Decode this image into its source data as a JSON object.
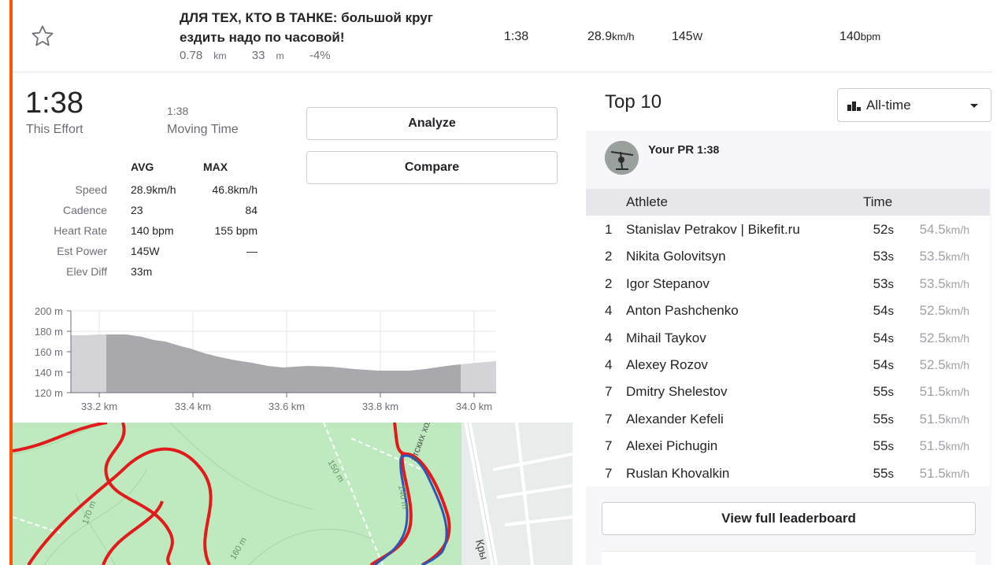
{
  "segment": {
    "title": "ДЛЯ ТЕХ, КТО В ТАНКЕ: большой круг ездить надо по часовой!",
    "distance_value": "0.78",
    "distance_unit": "km",
    "elev_value": "33",
    "elev_unit": "m",
    "grade": "-4%",
    "time": "1:38",
    "speed_value": "28.9",
    "speed_unit": "km/h",
    "power_value": "145",
    "power_unit": "W",
    "hr_value": "140",
    "hr_unit": "bpm"
  },
  "effort": {
    "time": "1:38",
    "time_label": "This Effort",
    "moving_time": "1:38",
    "moving_label": "Moving Time"
  },
  "buttons": {
    "analyze": "Analyze",
    "compare": "Compare"
  },
  "stats": {
    "avg_header": "AVG",
    "max_header": "MAX",
    "rows": [
      {
        "label": "Speed",
        "avg": "28.9km/h",
        "max": "46.8km/h"
      },
      {
        "label": "Cadence",
        "avg": "23",
        "max": "84"
      },
      {
        "label": "Heart Rate",
        "avg": "140 bpm",
        "max": "155 bpm"
      },
      {
        "label": "Est Power",
        "avg": "145W",
        "max": "—"
      },
      {
        "label": "Elev Diff",
        "avg": "33m",
        "max": ""
      }
    ]
  },
  "elevation_chart": {
    "y_ticks": [
      "200 m",
      "180 m",
      "160 m",
      "140 m",
      "120 m"
    ],
    "x_ticks": [
      "33.2 km",
      "33.4 km",
      "33.6 km",
      "33.8 km",
      "34.0 km"
    ]
  },
  "map_labels": {
    "contour_150": "150 m",
    "contour_170": "170 m",
    "contour_160": "160 m",
    "contour_140": "140 m",
    "street": "атских холмах",
    "street2": "Кры"
  },
  "leaderboard": {
    "title": "Top 10",
    "filter_label": "All-time",
    "pr_label": "Your PR",
    "pr_time": "1:38",
    "header_athlete": "Athlete",
    "header_time": "Time",
    "rows": [
      {
        "rank": "1",
        "name": "Stanislav Petrakov | Bikefit.ru",
        "time": "52",
        "speed": "54.5"
      },
      {
        "rank": "2",
        "name": "Nikita Golovitsyn",
        "time": "53",
        "speed": "53.5"
      },
      {
        "rank": "2",
        "name": "Igor Stepanov",
        "time": "53",
        "speed": "53.5"
      },
      {
        "rank": "4",
        "name": "Anton Pashchenko",
        "time": "54",
        "speed": "52.5"
      },
      {
        "rank": "4",
        "name": "Mihail Taykov",
        "time": "54",
        "speed": "52.5"
      },
      {
        "rank": "4",
        "name": "Alexey Rozov",
        "time": "54",
        "speed": "52.5"
      },
      {
        "rank": "7",
        "name": "Dmitry Shelestov",
        "time": "55",
        "speed": "51.5"
      },
      {
        "rank": "7",
        "name": "Alexander Kefeli",
        "time": "55",
        "speed": "51.5"
      },
      {
        "rank": "7",
        "name": "Alexei Pichugin",
        "time": "55",
        "speed": "51.5"
      },
      {
        "rank": "7",
        "name": "Ruslan Khovalkin",
        "time": "55",
        "speed": "51.5"
      }
    ],
    "time_unit": "s",
    "speed_unit": "km/h",
    "view_full": "View full leaderboard"
  },
  "colors": {
    "accent": "#fc5200",
    "route_red": "#e11b1b",
    "route_blue": "#2a57b8",
    "map_green": "#bfeabf"
  }
}
